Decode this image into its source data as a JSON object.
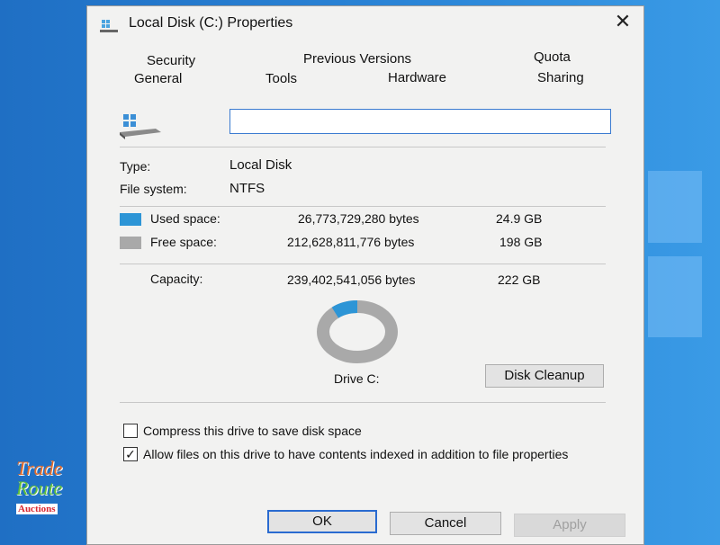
{
  "colors": {
    "used": "#2d95d6",
    "free": "#a9a9a9",
    "accent": "#2a6bd0"
  },
  "dialog": {
    "title": "Local Disk (C:) Properties",
    "close_glyph": "✕"
  },
  "tabs": {
    "row1": [
      "Security",
      "Previous Versions",
      "Quota"
    ],
    "row2": [
      "General",
      "Tools",
      "Hardware",
      "Sharing"
    ]
  },
  "name_field": {
    "value": ""
  },
  "info": {
    "type_label": "Type:",
    "type_value": "Local Disk",
    "fs_label": "File system:",
    "fs_value": "NTFS"
  },
  "space": {
    "used_label": "Used space:",
    "used_bytes": "26,773,729,280 bytes",
    "used_gb": "24.9 GB",
    "free_label": "Free space:",
    "free_bytes": "212,628,811,776 bytes",
    "free_gb": "198 GB",
    "capacity_label": "Capacity:",
    "capacity_bytes": "239,402,541,056 bytes",
    "capacity_gb": "222 GB",
    "used_fraction": 0.112
  },
  "drive": {
    "label": "Drive C:",
    "cleanup_label": "Disk Cleanup"
  },
  "options": {
    "compress_label": "Compress this drive to save disk space",
    "compress_checked": false,
    "index_label": "Allow files on this drive to have contents indexed in addition to file properties",
    "index_checked": true
  },
  "buttons": {
    "ok": "OK",
    "cancel": "Cancel",
    "apply": "Apply"
  },
  "watermark": {
    "line1": "Trade",
    "line2": "Route",
    "line3": "Auctions"
  }
}
